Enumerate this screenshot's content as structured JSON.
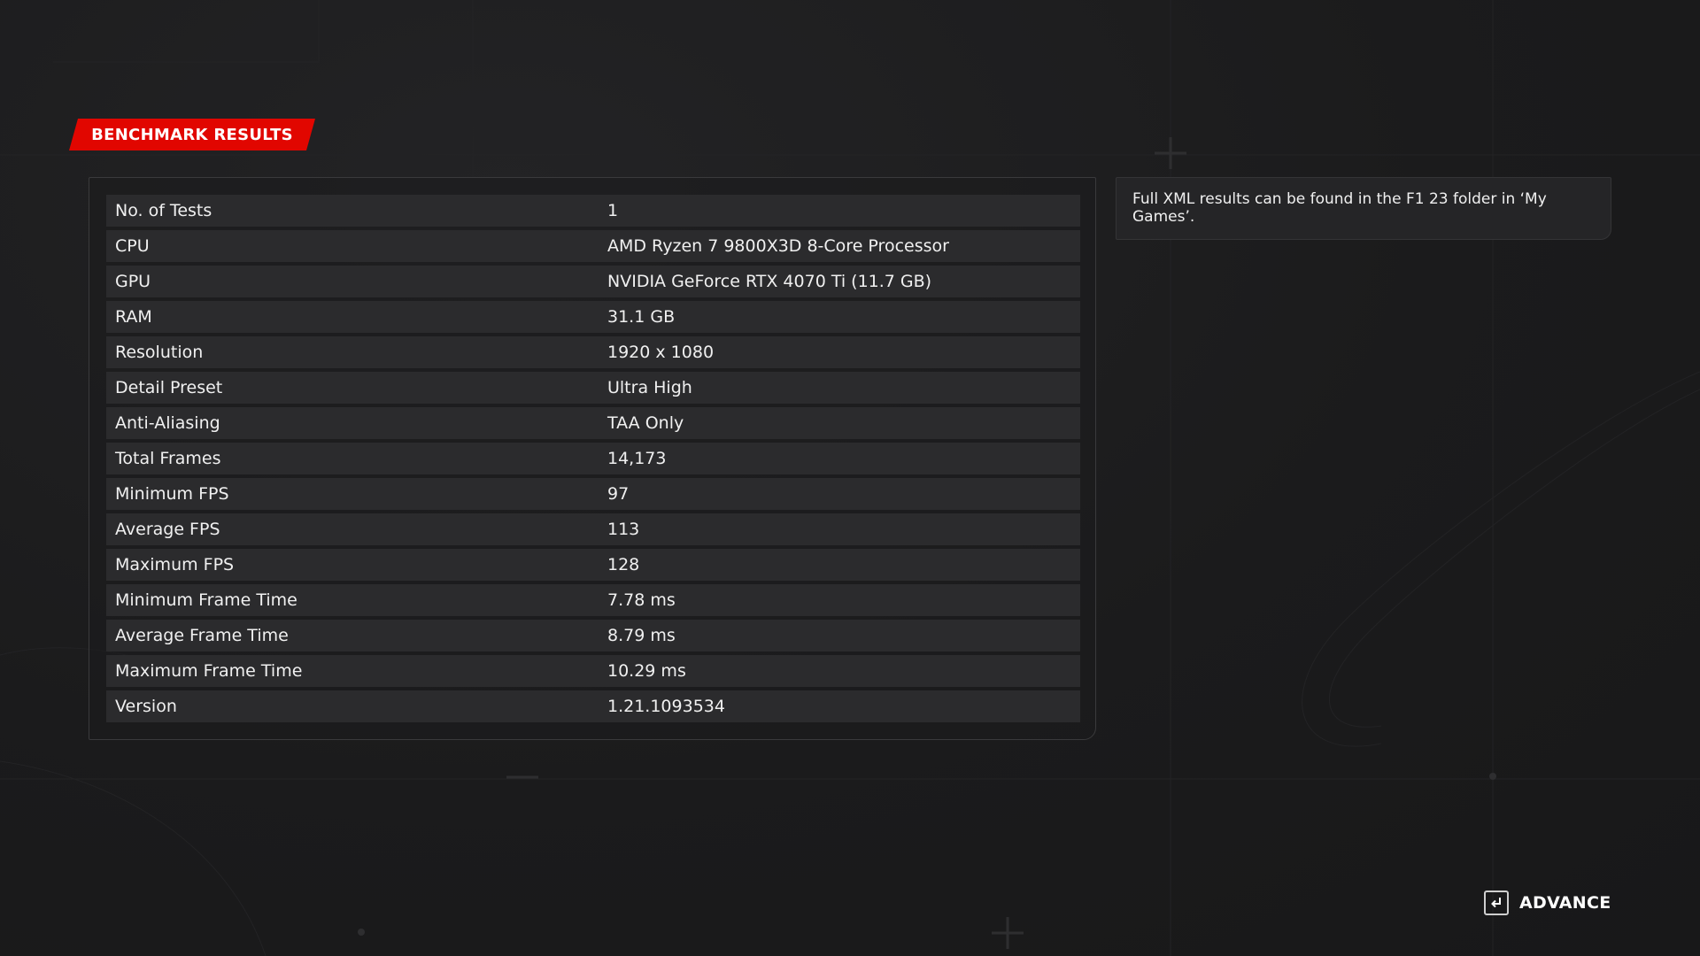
{
  "header": {
    "title": "BENCHMARK RESULTS"
  },
  "results": [
    {
      "label": "No. of Tests",
      "value": "1"
    },
    {
      "label": "CPU",
      "value": "AMD Ryzen 7 9800X3D 8-Core Processor"
    },
    {
      "label": "GPU",
      "value": "NVIDIA GeForce RTX 4070 Ti (11.7 GB)"
    },
    {
      "label": "RAM",
      "value": "31.1 GB"
    },
    {
      "label": "Resolution",
      "value": "1920 x 1080"
    },
    {
      "label": "Detail Preset",
      "value": "Ultra High"
    },
    {
      "label": "Anti-Aliasing",
      "value": "TAA Only"
    },
    {
      "label": "Total Frames",
      "value": "14,173"
    },
    {
      "label": "Minimum FPS",
      "value": "97"
    },
    {
      "label": "Average FPS",
      "value": "113"
    },
    {
      "label": "Maximum FPS",
      "value": "128"
    },
    {
      "label": "Minimum Frame Time",
      "value": "7.78 ms"
    },
    {
      "label": "Average Frame Time",
      "value": "8.79 ms"
    },
    {
      "label": "Maximum Frame Time",
      "value": "10.29 ms"
    },
    {
      "label": "Version",
      "value": "1.21.1093534"
    }
  ],
  "info": {
    "text": "Full XML results can be found in the F1 23 folder in ‘My Games’."
  },
  "footer": {
    "advance_label": "ADVANCE",
    "advance_icon": "enter-key-icon"
  },
  "colors": {
    "accent": "#e10600",
    "background": "#1a1a1b",
    "row_background": "#2b2b2d"
  }
}
